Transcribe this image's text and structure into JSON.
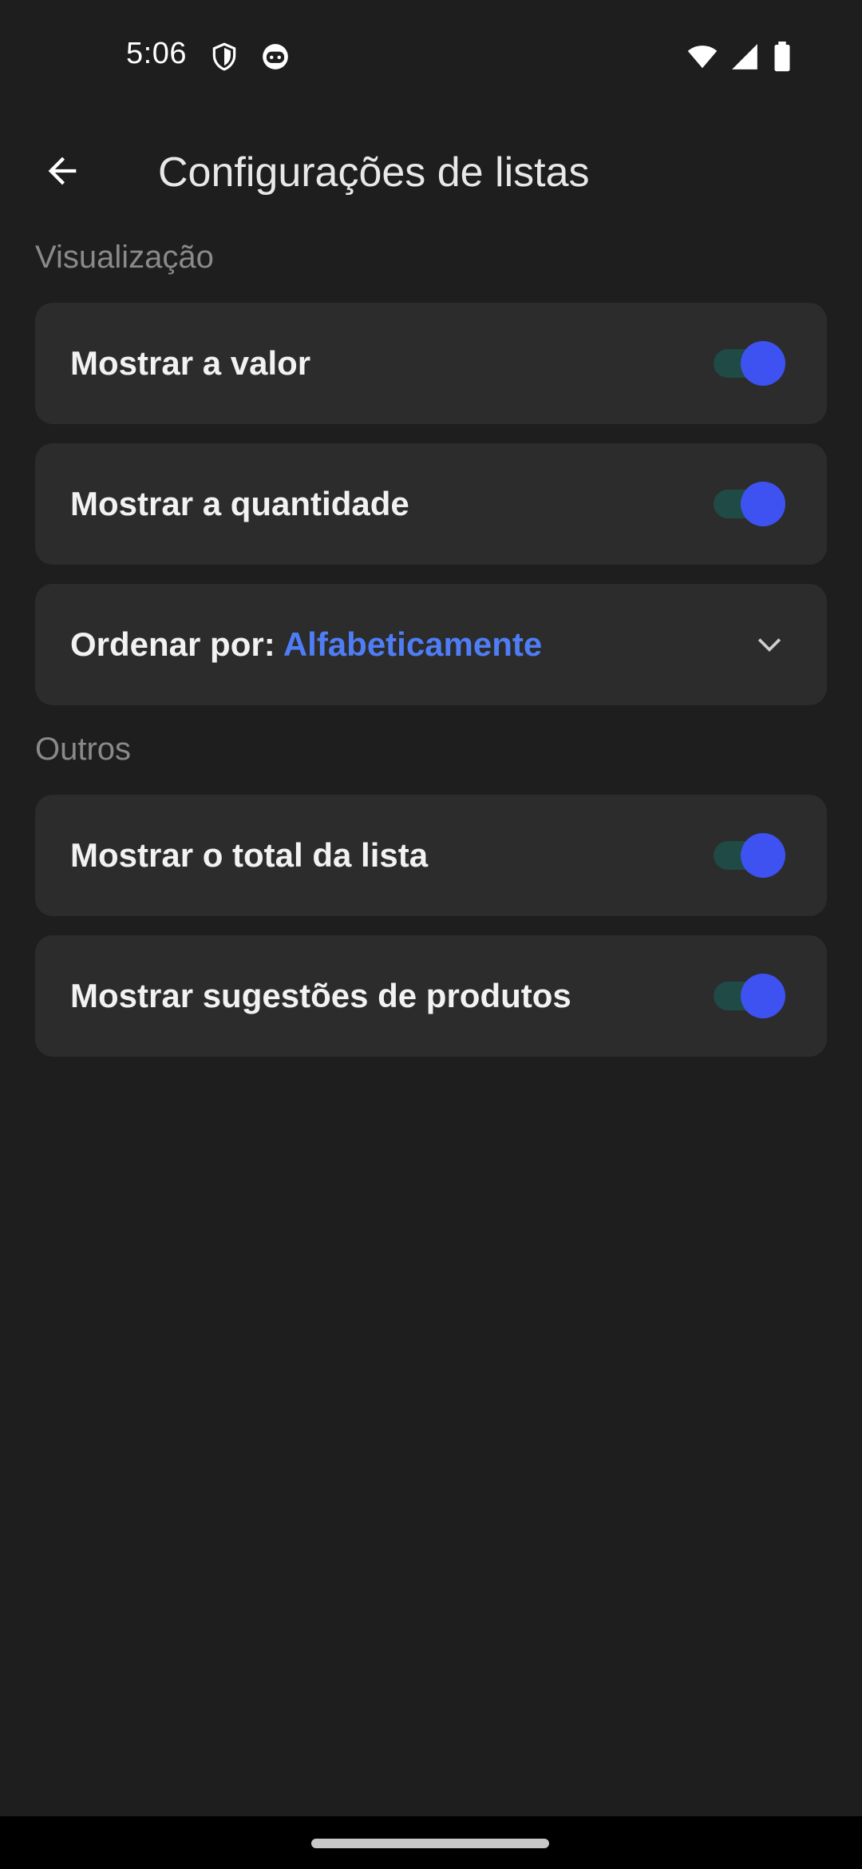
{
  "status_bar": {
    "time": "5:06",
    "left_icons": [
      "shield-icon",
      "android-face-icon"
    ],
    "right_icons": [
      "wifi-icon",
      "cell-signal-icon",
      "battery-icon"
    ]
  },
  "app_bar": {
    "back_icon": "arrow-back-icon",
    "title": "Configurações de listas"
  },
  "sections": [
    {
      "header": "Visualização",
      "items": [
        {
          "label": "Mostrar a valor",
          "type": "toggle",
          "on": true
        },
        {
          "label": "Mostrar a quantidade",
          "type": "toggle",
          "on": true
        },
        {
          "label": "Ordenar por:",
          "value": "Alfabeticamente",
          "type": "dropdown"
        }
      ]
    },
    {
      "header": "Outros",
      "items": [
        {
          "label": "Mostrar o total da lista",
          "type": "toggle",
          "on": true
        },
        {
          "label": "Mostrar sugestões de produtos",
          "type": "toggle",
          "on": true
        }
      ]
    }
  ],
  "colors": {
    "background": "#1e1e1e",
    "card": "#2c2c2c",
    "accent": "#4f7df5",
    "toggle_thumb": "#3d52f0",
    "toggle_track": "#1f4a46",
    "section_header": "#8a8a8a"
  }
}
